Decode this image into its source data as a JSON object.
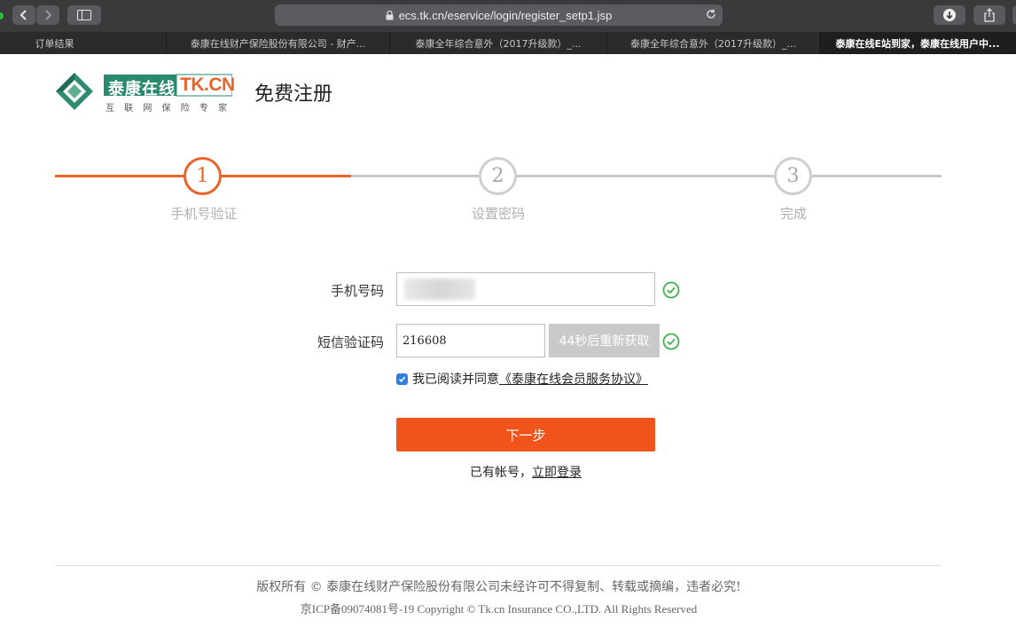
{
  "browser": {
    "url": "ecs.tk.cn/eservice/login/register_setp1.jsp",
    "tabs": [
      {
        "label": "订单结果",
        "active": false
      },
      {
        "label": "泰康在线财产保险股份有限公司 - 财产...",
        "active": false
      },
      {
        "label": "泰康全年综合意外（2017升级款）_...",
        "active": false
      },
      {
        "label": "泰康全年综合意外（2017升级款）_...",
        "active": false
      },
      {
        "label": "泰康在线E站到家，泰康在线用户中...",
        "active": true
      }
    ]
  },
  "header": {
    "logo_cn": "泰康在线",
    "logo_en": "TK.CN",
    "logo_slogan": "互 联 网 保 险 专 家",
    "title": "免费注册"
  },
  "steps": [
    {
      "number": "1",
      "label": "手机号验证",
      "state": "active"
    },
    {
      "number": "2",
      "label": "设置密码",
      "state": "pending"
    },
    {
      "number": "3",
      "label": "完成",
      "state": "pending"
    }
  ],
  "form": {
    "phone_label": "手机号码",
    "code_label": "短信验证码",
    "code_value": "216608",
    "resend_label": "44秒后重新获取",
    "agree_text": "我已阅读并同意",
    "agree_link": "《泰康在线会员服务协议》",
    "next_label": "下一步",
    "have_account": "已有帐号，",
    "login_link": "立即登录"
  },
  "footer": {
    "line1": "版权所有 © 泰康在线财产保险股份有限公司未经许可不得复制、转载或摘编，违者必究!",
    "line2": "京ICP备09074081号-19 Copyright © Tk.cn Insurance CO.,LTD. All Rights Reserved"
  },
  "colors": {
    "accent": "#f1541b",
    "step_active": "#e8642a",
    "step_pending": "#c8c8c8",
    "success": "#3fb24f",
    "brand_green": "#2a8a6e"
  }
}
